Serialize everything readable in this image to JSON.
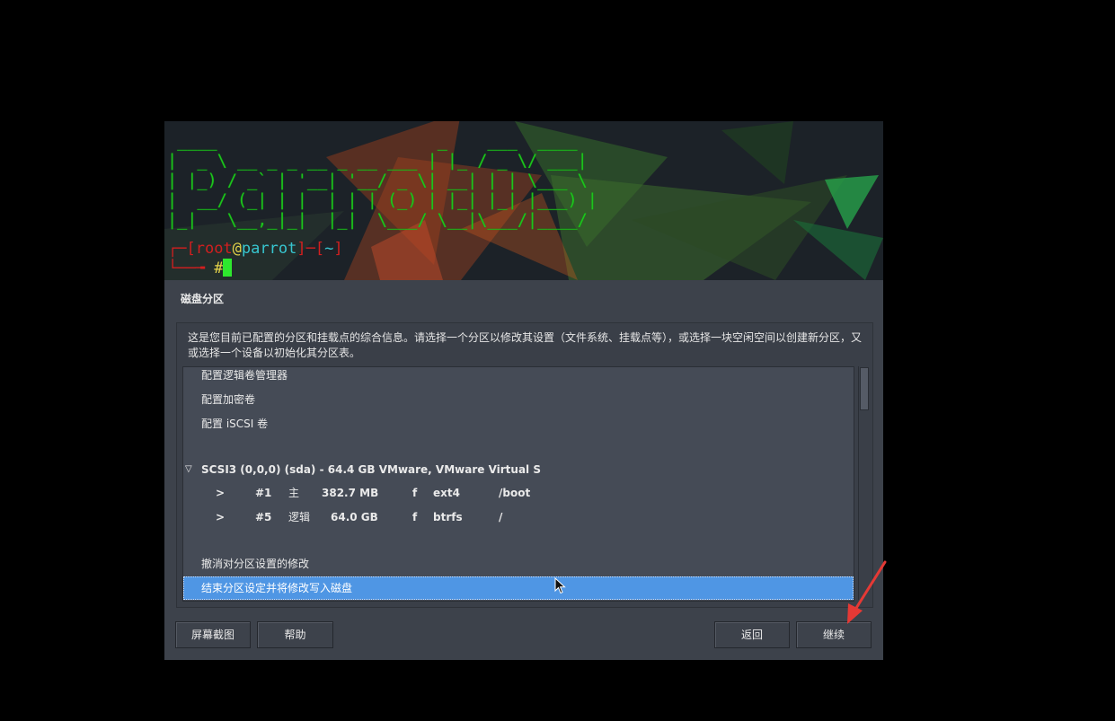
{
  "desktop": {
    "ascii_logo": " ____                      _    ___  ____  \n|  _ \\ __ _ _ __ _ __ ___ | |_ / _ \\/ ___| \n| |_) / _` | '__| '__/ _ \\| __| | | \\___ \\ \n|  __/ (_| | |  | | | (_) | |_| |_| |___) |\n|_|   \\__,_|_|  |_|  \\___/ \\__|\\___/|____/ ",
    "prompt_user": "root",
    "prompt_at": "@",
    "prompt_host": "parrot",
    "prompt_dir": "~",
    "prompt_symbol": "#"
  },
  "window": {
    "title": "磁盘分区",
    "description": "这是您目前已配置的分区和挂载点的综合信息。请选择一个分区以修改其设置（文件系统、挂载点等），或选择一块空闲空间以创建新分区，又或选择一个设备以初始化其分区表。"
  },
  "list": {
    "items": [
      {
        "label": "配置逻辑卷管理器"
      },
      {
        "label": "配置加密卷"
      },
      {
        "label": "配置 iSCSI 卷"
      }
    ],
    "disk": {
      "expander": "▽",
      "label": "SCSI3 (0,0,0) (sda) - 64.4 GB VMware, VMware Virtual S"
    },
    "partitions": [
      {
        "arrow": ">",
        "number": "#1",
        "type": "主",
        "size": "382.7 MB",
        "flag": "f",
        "fs": "ext4",
        "mount": "/boot"
      },
      {
        "arrow": ">",
        "number": "#5",
        "type": "逻辑",
        "size": "64.0 GB",
        "flag": "f",
        "fs": "btrfs",
        "mount": "/"
      }
    ],
    "undo": "撤消对分区设置的修改",
    "finish": "结束分区设定并将修改写入磁盘"
  },
  "buttons": {
    "screenshot": "屏幕截图",
    "help": "帮助",
    "back": "返回",
    "continue": "继续"
  },
  "colors": {
    "selection": "#4f96e4",
    "annotation_arrow": "#e53935",
    "terminal_green": "#1ec21e"
  },
  "icons": {
    "mouse": "mouse-pointer-icon",
    "annotation": "red-arrow-icon"
  }
}
